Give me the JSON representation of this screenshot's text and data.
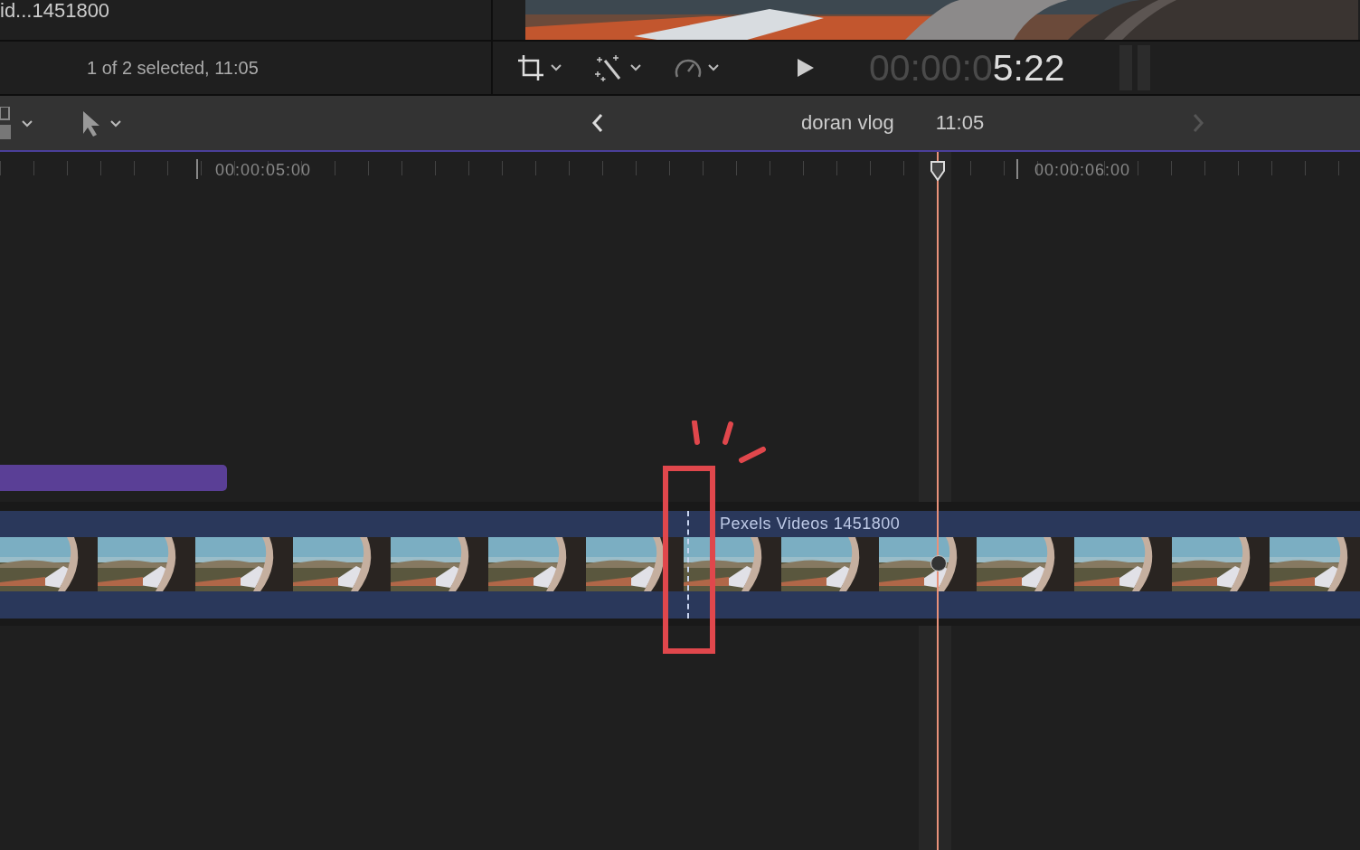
{
  "browser": {
    "clip_name": "id...1451800",
    "selection_info": "1 of 2 selected, 11:05"
  },
  "viewer_toolbar": {
    "timecode_dim": "00:00:0",
    "timecode_bright": "5:22"
  },
  "timeline_header": {
    "project": "doran vlog",
    "duration": "11:05"
  },
  "ruler": {
    "labels": [
      "00:00:05:00",
      "00:00:06:00"
    ]
  },
  "clip": {
    "title": "Pexels Videos 1451800"
  }
}
